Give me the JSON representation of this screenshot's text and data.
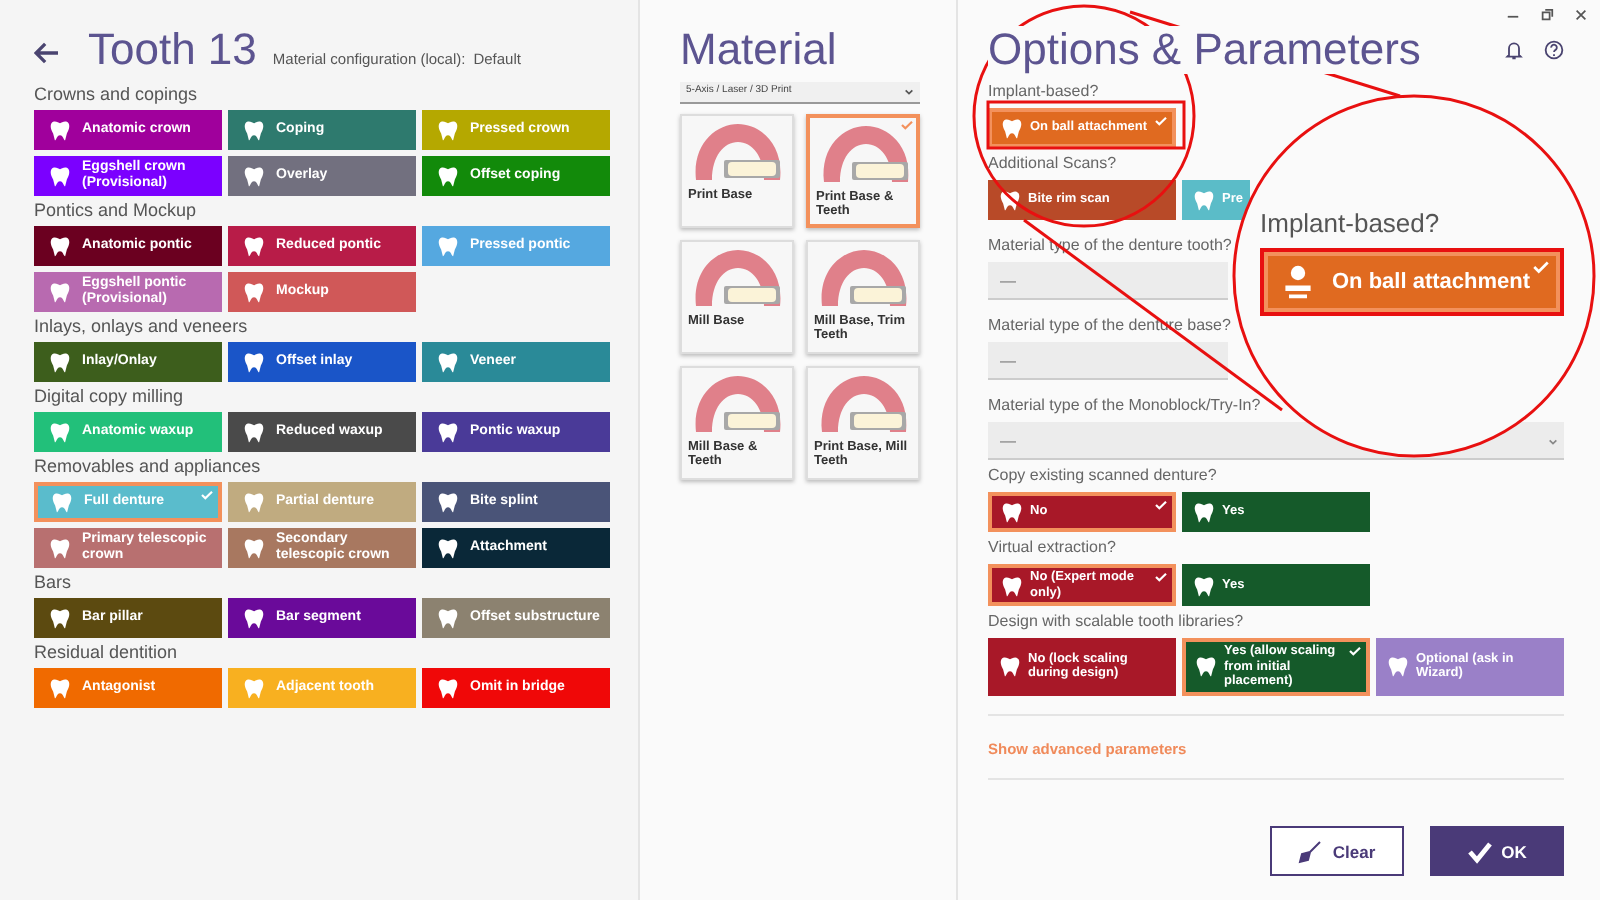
{
  "tooth": {
    "title": "Tooth 13",
    "subtitle": "Material configuration (local):",
    "subtitle_value": "Default"
  },
  "categories": [
    {
      "heading": "Crowns and copings",
      "items": [
        {
          "label": "Anatomic crown",
          "color": "#a0009c",
          "selected": false
        },
        {
          "label": "Coping",
          "color": "#2e7a6e",
          "selected": false
        },
        {
          "label": "Pressed crown",
          "color": "#b5a800",
          "selected": false
        },
        {
          "label": "Eggshell crown (Provisional)",
          "color": "#7b00ff",
          "selected": false
        },
        {
          "label": "Overlay",
          "color": "#72707f",
          "selected": false
        },
        {
          "label": "Offset coping",
          "color": "#128a0a",
          "selected": false
        }
      ]
    },
    {
      "heading": "Pontics and Mockup",
      "items": [
        {
          "label": "Anatomic pontic",
          "color": "#6b0020",
          "selected": false
        },
        {
          "label": "Reduced pontic",
          "color": "#b81c48",
          "selected": false
        },
        {
          "label": "Pressed pontic",
          "color": "#55a8e0",
          "selected": false
        },
        {
          "label": "Eggshell pontic (Provisional)",
          "color": "#b86ab0",
          "selected": false
        },
        {
          "label": "Mockup",
          "color": "#d05858",
          "selected": false
        }
      ]
    },
    {
      "heading": "Inlays, onlays and veneers",
      "items": [
        {
          "label": "Inlay/Onlay",
          "color": "#3d5e1c",
          "selected": false
        },
        {
          "label": "Offset inlay",
          "color": "#1a55c8",
          "selected": false
        },
        {
          "label": "Veneer",
          "color": "#2a8a98",
          "selected": false
        }
      ]
    },
    {
      "heading": "Digital copy milling",
      "items": [
        {
          "label": "Anatomic waxup",
          "color": "#22c07a",
          "selected": false
        },
        {
          "label": "Reduced waxup",
          "color": "#4a4a4a",
          "selected": false
        },
        {
          "label": "Pontic waxup",
          "color": "#4a3a98",
          "selected": false
        }
      ]
    },
    {
      "heading": "Removables and appliances",
      "items": [
        {
          "label": "Full denture",
          "color": "#5abccc",
          "selected": true
        },
        {
          "label": "Partial denture",
          "color": "#c0ab80",
          "selected": false
        },
        {
          "label": "Bite splint",
          "color": "#4a5478",
          "selected": false
        },
        {
          "label": "Primary telescopic crown",
          "color": "#b87070",
          "selected": false
        },
        {
          "label": "Secondary telescopic crown",
          "color": "#a87860",
          "selected": false
        },
        {
          "label": "Attachment",
          "color": "#0a2838",
          "selected": false
        }
      ]
    },
    {
      "heading": "Bars",
      "items": [
        {
          "label": "Bar pillar",
          "color": "#5c4a10",
          "selected": false
        },
        {
          "label": "Bar segment",
          "color": "#6a0a9a",
          "selected": false
        },
        {
          "label": "Offset substructure",
          "color": "#8c8270",
          "selected": false
        }
      ]
    },
    {
      "heading": "Residual dentition",
      "items": [
        {
          "label": "Antagonist",
          "color": "#f06a00",
          "selected": false
        },
        {
          "label": "Adjacent tooth",
          "color": "#f8b020",
          "selected": false
        },
        {
          "label": "Omit in bridge",
          "color": "#f00808",
          "selected": false
        }
      ]
    }
  ],
  "material": {
    "title": "Material",
    "dropdown": "5-Axis / Laser / 3D Print",
    "tiles": [
      {
        "label": "Print Base",
        "selected": false
      },
      {
        "label": "Print Base & Teeth",
        "selected": true
      },
      {
        "label": "Mill Base",
        "selected": false
      },
      {
        "label": "Mill Base, Trim Teeth",
        "selected": false
      },
      {
        "label": "Mill Base & Teeth",
        "selected": false
      },
      {
        "label": "Print Base, Mill Teeth",
        "selected": false
      }
    ]
  },
  "options": {
    "title": "Options & Parameters",
    "groups": [
      {
        "kind": "buttons",
        "question": "Implant-based?",
        "choices": [
          {
            "label": "On ball attachment",
            "color": "#e06a20",
            "selected": true
          }
        ]
      },
      {
        "kind": "buttons",
        "question": "Additional Scans?",
        "choices": [
          {
            "label": "Bite rim scan",
            "color": "#b84a28",
            "selected": false
          },
          {
            "label": "Pre",
            "color": "#5bbcc8",
            "selected": false
          }
        ]
      },
      {
        "kind": "select",
        "question": "Material type of the denture tooth?",
        "value": "—"
      },
      {
        "kind": "select",
        "question": "Material type of the denture base?",
        "value": "—"
      },
      {
        "kind": "select",
        "question": "Material type of the Monoblock/Try-In?",
        "value": "—"
      },
      {
        "kind": "buttons",
        "question": "Copy existing scanned denture?",
        "choices": [
          {
            "label": "No",
            "color": "#a81828",
            "selected": true
          },
          {
            "label": "Yes",
            "color": "#155a2a",
            "selected": false
          }
        ]
      },
      {
        "kind": "buttons",
        "question": "Virtual extraction?",
        "choices": [
          {
            "label": "No (Expert mode only)",
            "color": "#a81828",
            "selected": true
          },
          {
            "label": "Yes",
            "color": "#155a2a",
            "selected": false
          }
        ]
      },
      {
        "kind": "buttons",
        "question": "Design with scalable tooth libraries?",
        "choices": [
          {
            "label": "No (lock scaling during design)",
            "color": "#a81828",
            "selected": false
          },
          {
            "label": "Yes (allow scaling from initial placement)",
            "color": "#155a2a",
            "selected": true
          },
          {
            "label": "Optional (ask in Wizard)",
            "color": "#9a80c8",
            "selected": false
          }
        ]
      }
    ],
    "advanced_link": "Show advanced parameters",
    "actions": [
      {
        "label": "Clear",
        "kind": "secondary"
      },
      {
        "label": "OK",
        "kind": "primary"
      }
    ]
  },
  "magnifier": {
    "question": "Implant-based?",
    "choice": {
      "label": "On ball attachment",
      "color": "#e06a20",
      "selected": true
    }
  }
}
